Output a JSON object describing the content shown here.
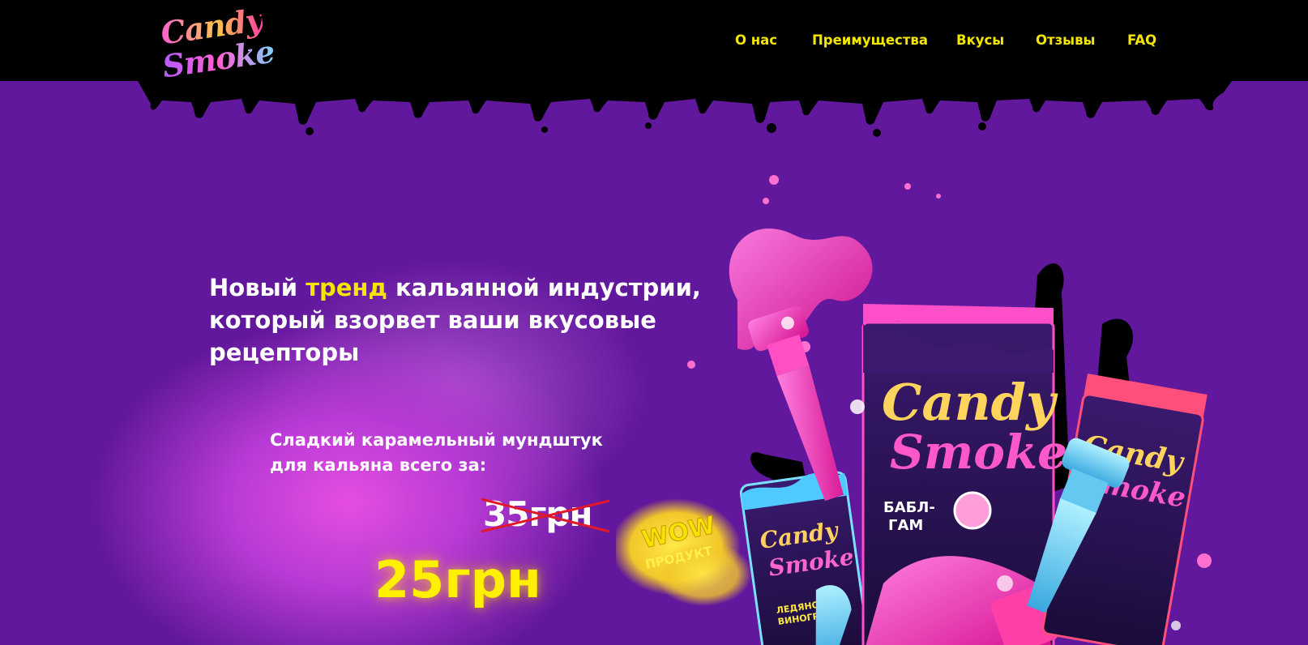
{
  "brand": {
    "logo_line1": "Candy",
    "logo_line2": "Smoke"
  },
  "nav": {
    "items": [
      {
        "label": "О нас"
      },
      {
        "label": "Преимущества"
      },
      {
        "label": "Вкусы"
      },
      {
        "label": "Отзывы"
      },
      {
        "label": "FAQ"
      }
    ]
  },
  "hero": {
    "headline_part1": "Новый ",
    "headline_accent": "тренд",
    "headline_part2": " кальянной индустрии, который взорвет ваши вкусовые рецепторы",
    "subtext": "Сладкий карамельный мундштук для кальяна всего за:",
    "old_price": "35грн",
    "new_price": "25грн",
    "badge_line1": "WOW",
    "badge_line2": "ПРОДУКТ"
  },
  "products": {
    "pack_brand_line1": "Candy",
    "pack_brand_line2": "Smoke",
    "center_flavor_line1": "БАБЛ-",
    "center_flavor_line2": "ГАМ",
    "left_flavor_line1": "ЛЕДЯНОЙ",
    "left_flavor_line2": "ВИНОГРАД"
  },
  "colors": {
    "accent_yellow": "#f4e600",
    "price_yellow": "#ffef00",
    "hero_purple": "#62189c",
    "header_black": "#000000",
    "pink": "#ff3fb8"
  }
}
